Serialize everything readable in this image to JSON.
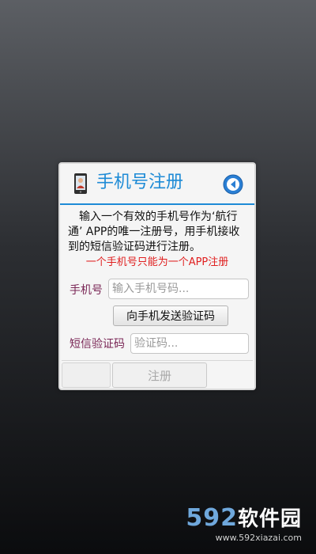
{
  "dialog": {
    "title": "手机号注册",
    "description": "输入一个有效的手机号作为‘航行通’ APP的唯一注册号，用手机接收到的短信验证码进行注册。",
    "warning": "一个手机号只能为一个APP注册",
    "phone": {
      "label": "手机号",
      "placeholder": "输入手机号码...",
      "value": ""
    },
    "send_code_label": "向手机发送验证码",
    "sms_code": {
      "label": "短信验证码",
      "placeholder": "验证码...",
      "value": ""
    },
    "register_label": "注册"
  },
  "icons": {
    "title_icon": "phone-user-icon",
    "back_icon": "back-arrow-icon"
  },
  "watermark": {
    "logo_num": "592",
    "logo_cn": "软件园",
    "url": "www.592xiazai.com"
  },
  "colors": {
    "accent": "#1e8bd6",
    "warning": "#e01f1f",
    "label": "#7a2756"
  }
}
